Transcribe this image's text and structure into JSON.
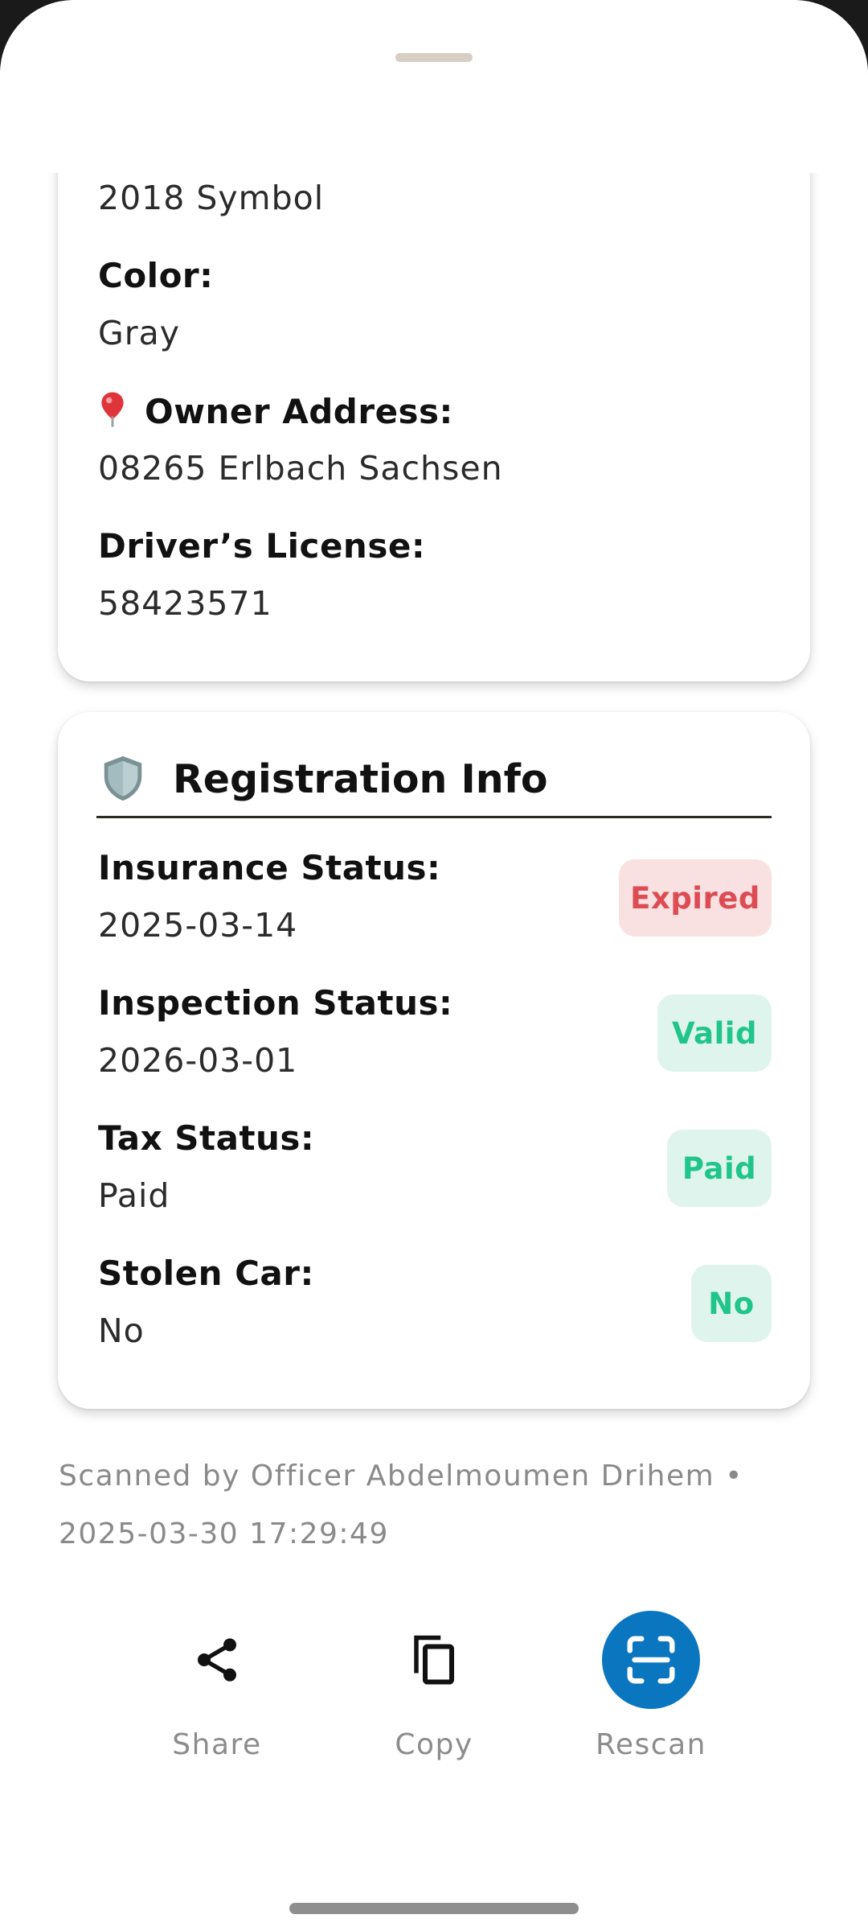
{
  "vehicle": {
    "model_value": "2018 Symbol",
    "color_label": "Color:",
    "color_value": "Gray",
    "owner_address_label": "Owner Address:",
    "owner_address_value": "08265  Erlbach Sachsen",
    "drivers_license_label": "Driver’s License:",
    "drivers_license_value": "58423571"
  },
  "registration": {
    "title": "Registration Info",
    "rows": [
      {
        "label": "Insurance Status:",
        "value": "2025-03-14",
        "badge": "Expired",
        "badge_status": "error"
      },
      {
        "label": "Inspection Status:",
        "value": "2026-03-01",
        "badge": "Valid",
        "badge_status": "ok"
      },
      {
        "label": "Tax Status:",
        "value": "Paid",
        "badge": "Paid",
        "badge_status": "ok"
      },
      {
        "label": "Stolen Car:",
        "value": "No",
        "badge": "No",
        "badge_status": "ok"
      }
    ]
  },
  "footer": {
    "scanned_line1": "Scanned by Officer Abdelmoumen Drihem •",
    "scanned_line2": "2025-03-30 17:29:49"
  },
  "actions": {
    "share_label": "Share",
    "copy_label": "Copy",
    "rescan_label": "Rescan"
  },
  "colors": {
    "accent": "#0a76c0",
    "badge_error_bg": "#f9e1e2",
    "badge_error_text": "#dd4b53",
    "badge_ok_bg": "#dff4ec",
    "badge_ok_text": "#1fc58a"
  },
  "icons": [
    "location-pin-icon",
    "shield-icon",
    "share-icon",
    "copy-icon",
    "scan-icon"
  ]
}
